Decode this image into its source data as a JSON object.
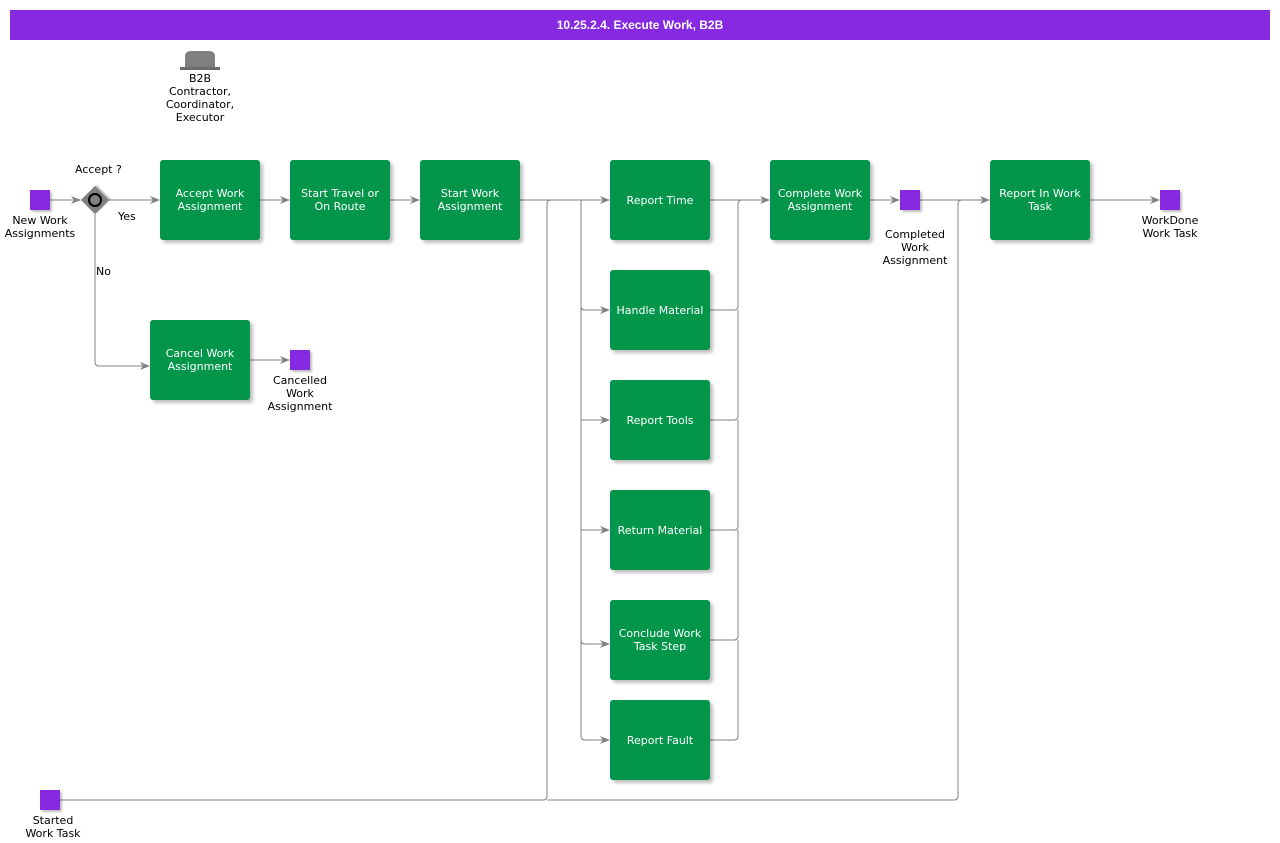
{
  "header": {
    "title": "10.25.2.4. Execute Work, B2B"
  },
  "colors": {
    "accent": "#8629e0",
    "task": "#03964a",
    "line": "#808080",
    "gateway": "#808080"
  },
  "role": {
    "icon": "hat-icon",
    "label_lines": [
      "B2B",
      "Contractor,",
      "Coordinator,",
      "Executor"
    ]
  },
  "gateway": {
    "label": "Accept ?",
    "yes": "Yes",
    "no": "No"
  },
  "events": {
    "new_work": [
      "New Work",
      "Assignments"
    ],
    "cancelled": [
      "Cancelled",
      "Work",
      "Assignment"
    ],
    "completed": [
      "Completed",
      "Work",
      "Assignment"
    ],
    "workdone": [
      "WorkDone",
      "Work Task"
    ],
    "started": [
      "Started",
      "Work Task"
    ]
  },
  "tasks": {
    "accept": "Accept Work Assignment",
    "travel": "Start Travel or On Route",
    "start": "Start Work Assignment",
    "cancel": "Cancel Work Assignment",
    "report_time": "Report Time",
    "handle_material": "Handle Material",
    "report_tools": "Report Tools",
    "return_material": "Return Material",
    "conclude_step": "Conclude Work Task Step",
    "report_fault": "Report Fault",
    "complete": "Complete Work Assignment",
    "report_in": "Report In Work Task"
  }
}
